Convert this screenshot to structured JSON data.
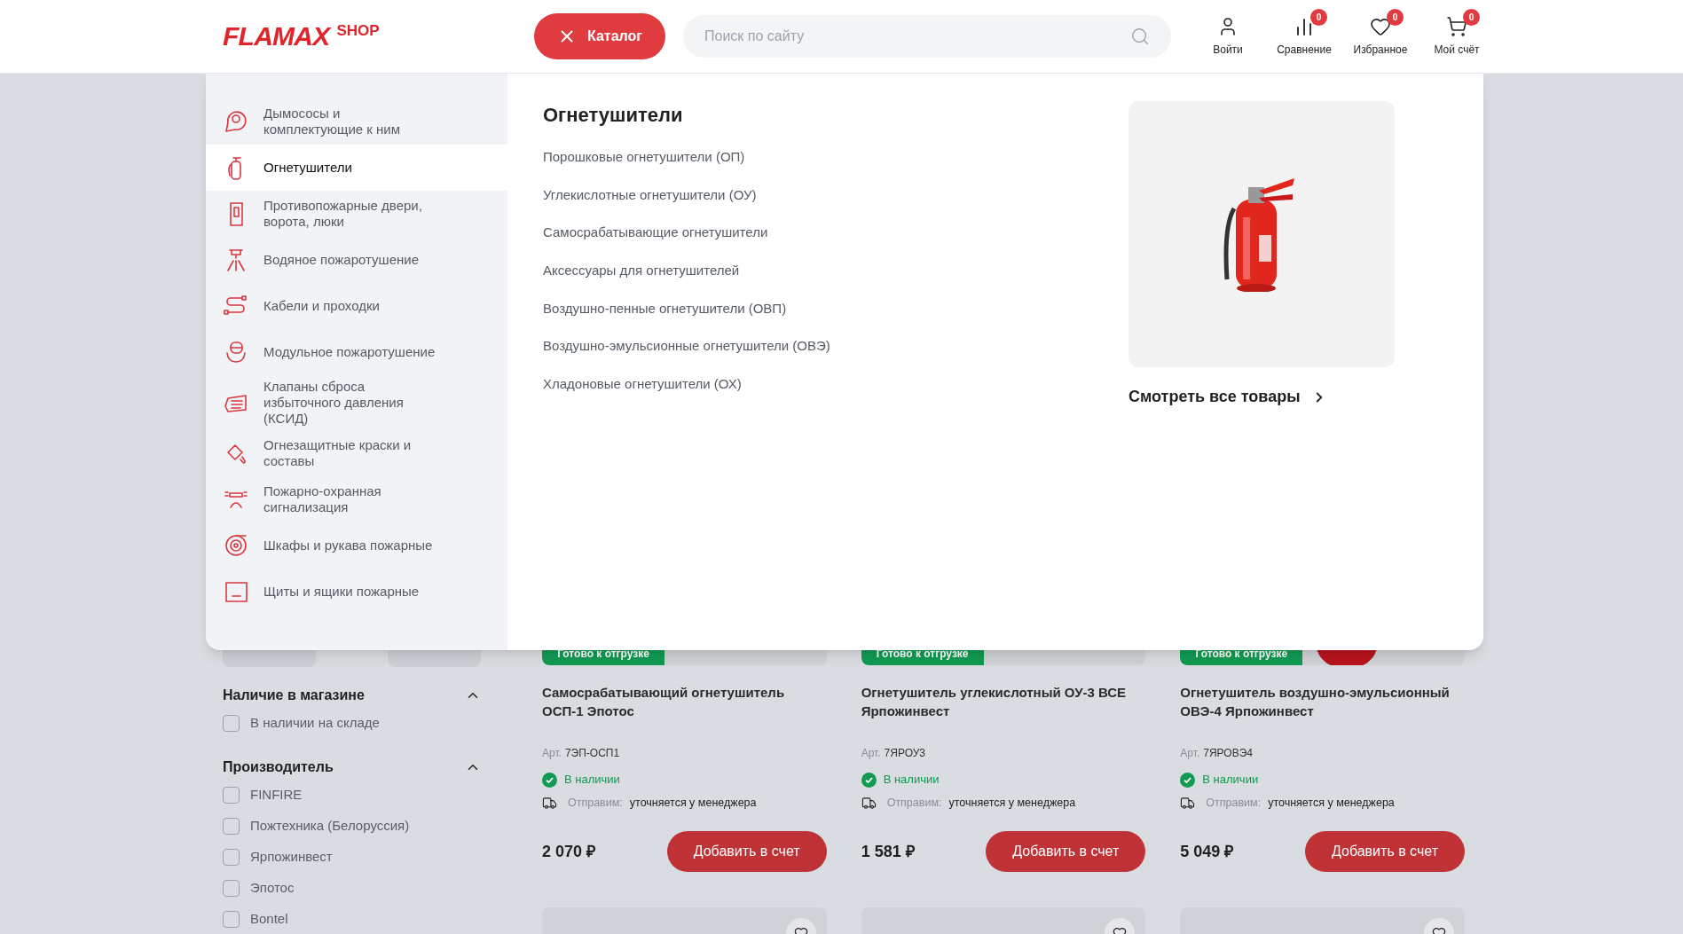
{
  "header": {
    "logo": {
      "brand": "FLAMAX",
      "suffix": "SHOP"
    },
    "catalog_button": "Каталог",
    "search": {
      "placeholder": "Поиск по сайту"
    },
    "actions": [
      {
        "kind": "user",
        "label": "Войти"
      },
      {
        "kind": "compare",
        "label": "Сравнение",
        "badge": "0"
      },
      {
        "kind": "favorites",
        "label": "Избранное",
        "badge": "0"
      },
      {
        "kind": "cart",
        "label": "Мой счёт",
        "badge": "0"
      }
    ]
  },
  "catalog_menu": {
    "categories": [
      {
        "label": "Дымососы и комплектующие к ним",
        "selected": false
      },
      {
        "label": "Огнетушители",
        "selected": true
      },
      {
        "label": "Противопожарные двери, ворота, люки",
        "selected": false
      },
      {
        "label": "Водяное пожаротушение",
        "selected": false
      },
      {
        "label": "Кабели и проходки",
        "selected": false
      },
      {
        "label": "Модульное пожаротушение",
        "selected": false
      },
      {
        "label": "Клапаны сброса избыточного давления (КСИД)",
        "selected": false
      },
      {
        "label": "Огнезащитные краски и составы",
        "selected": false
      },
      {
        "label": "Пожарно-охранная сигнализация",
        "selected": false
      },
      {
        "label": "Шкафы и рукава пожарные",
        "selected": false
      },
      {
        "label": "Щиты и ящики пожарные",
        "selected": false
      }
    ],
    "title": "Огнетушители",
    "subcategories": [
      "Порошковые огнетушители (ОП)",
      "Углекислотные огнетушители (ОУ)",
      "Самосрабатывающие огнетушители",
      "Аксессуары для огнетушителей",
      "Воздушно-пенные огнетушители (ОВП)",
      "Воздушно-эмульсионные огнетушители (ОВЭ)",
      "Хладоновые огнетушители (ОХ)"
    ],
    "view_all": "Смотреть все товары"
  },
  "filters": [
    {
      "title": "Наличие в магазине",
      "expanded": true,
      "options": [
        {
          "label": "В наличии на складе",
          "checked": false
        }
      ]
    },
    {
      "title": "Производитель",
      "expanded": true,
      "options": [
        {
          "label": "FINFIRE",
          "checked": false
        },
        {
          "label": "Пожтехника (Белоруссия)",
          "checked": false
        },
        {
          "label": "Ярпожинвест",
          "checked": false
        },
        {
          "label": "Эпотос",
          "checked": false
        },
        {
          "label": "Bontel",
          "checked": false
        }
      ]
    }
  ],
  "products": [
    {
      "badge": "Готово к отгрузке",
      "title": "Самосрабатывающий огнетушитель ОСП-1 Эпотос",
      "article_label": "Арт.",
      "article": "7ЭП-ОСП1",
      "availability": "В наличии",
      "shipping_label": "Отправим:",
      "shipping_value": "уточняется у менеджера",
      "price": "2 070 ₽",
      "button": "Добавить в счет"
    },
    {
      "badge": "Готово к отгрузке",
      "title": "Огнетушитель углекислотный ОУ-3 ВСЕ Ярпожинвест",
      "article_label": "Арт.",
      "article": "7ЯРОУ3",
      "availability": "В наличии",
      "shipping_label": "Отправим:",
      "shipping_value": "уточняется у менеджера",
      "price": "1 581 ₽",
      "button": "Добавить в счет"
    },
    {
      "badge": "Готово к отгрузке",
      "title": "Огнетушитель воздушно-эмульсионный ОВЭ-4 Ярпожинвест",
      "article_label": "Арт.",
      "article": "7ЯРОВЭ4",
      "availability": "В наличии",
      "shipping_label": "Отправим:",
      "shipping_value": "уточняется у менеджера",
      "price": "5 049 ₽",
      "button": "Добавить в счет"
    }
  ]
}
